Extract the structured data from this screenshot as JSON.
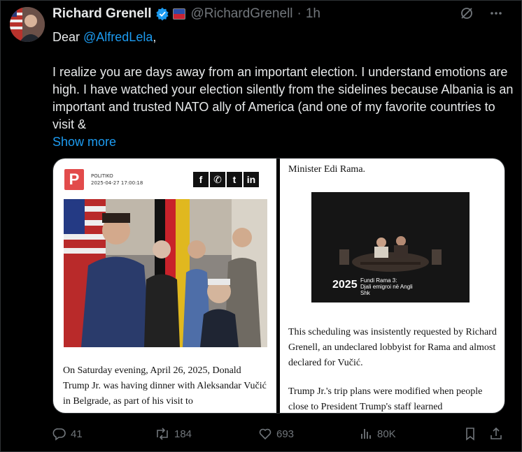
{
  "tweet": {
    "author_name": "Richard Grenell",
    "handle": "@RichardGrenell",
    "separator": "·",
    "time": "1h",
    "greeting": "Dear ",
    "mention": "@AlfredLela",
    "greeting_end": ",",
    "body": "I realize you are days away from an important election. I understand emotions are high. I have watched your election silently from the sidelines because Albania is an important and trusted NATO ally of America (and one of my favorite countries to visit &",
    "show_more": "Show more"
  },
  "article_left": {
    "logo_letter": "P",
    "publisher": "POLITIKO",
    "timestamp": "2025-04-27 17:00:18",
    "social": [
      "f",
      "✆",
      "t",
      "in"
    ],
    "text": "On Saturday evening, April 26, 2025, Donald Trump Jr. was having dinner with Aleksandar Vučić in Belgrade, as part of his visit to"
  },
  "article_right": {
    "top_text": "Minister Edi Rama.",
    "video_year": "2025",
    "video_title_line1": "Fundi Rama 3:",
    "video_title_line2": "Djali emigroi në Angli",
    "video_title_line3": "Shk",
    "para1": "This scheduling was insistently requested by Richard Grenell, an undeclared lobbyist for Rama and almost declared for Vučić.",
    "para2": "Trump Jr.'s trip plans were modified when people close to President Trump's staff learned"
  },
  "actions": {
    "replies": "41",
    "reposts": "184",
    "likes": "693",
    "views": "80K"
  },
  "colors": {
    "background": "#000000",
    "link": "#1d9bf0",
    "muted": "#71767b",
    "text": "#e7e9ea"
  },
  "icons": [
    "verified-badge-icon",
    "grok-icon",
    "more-icon",
    "reply-icon",
    "repost-icon",
    "like-icon",
    "views-icon",
    "bookmark-icon",
    "share-icon"
  ]
}
